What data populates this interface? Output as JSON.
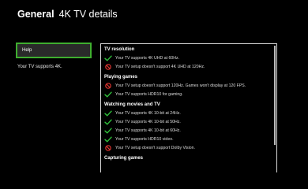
{
  "header": {
    "section": "General",
    "page": "4K TV details"
  },
  "sidebar": {
    "help_label": "Help",
    "status": "Your TV supports 4K."
  },
  "details": {
    "groups": [
      {
        "heading": "TV resolution",
        "items": [
          {
            "status": "pass",
            "icon": "check-icon",
            "text": "Your TV supports 4K UHD at 60Hz."
          },
          {
            "status": "fail",
            "icon": "not-supported-icon",
            "text": "Your TV setup doesn't support 4K UHD at 120Hz."
          }
        ]
      },
      {
        "heading": "Playing games",
        "items": [
          {
            "status": "fail",
            "icon": "not-supported-icon",
            "text": "Your TV setup doesn't support 120Hz. Games won't display at 120 FPS."
          },
          {
            "status": "pass",
            "icon": "check-icon",
            "text": "Your TV supports HDR10 for gaming."
          }
        ]
      },
      {
        "heading": "Watching movies and TV",
        "items": [
          {
            "status": "pass",
            "icon": "check-icon",
            "text": "Your TV supports 4K 10-bit at 24Hz."
          },
          {
            "status": "pass",
            "icon": "check-icon",
            "text": "Your TV supports 4K 10-bit at 50Hz."
          },
          {
            "status": "pass",
            "icon": "check-icon",
            "text": "Your TV supports 4K 10-bit at 60Hz."
          },
          {
            "status": "pass",
            "icon": "check-icon",
            "text": "Your TV supports HDR10 video."
          },
          {
            "status": "fail",
            "icon": "not-supported-icon",
            "text": "Your TV setup doesn't support Dolby Vision."
          }
        ]
      },
      {
        "heading": "Capturing games",
        "items": []
      }
    ]
  },
  "colors": {
    "background": "#000000",
    "focus_border": "#3fae2f",
    "pass": "#2fbf3a",
    "fail": "#e0342f",
    "panel_border": "#d9d9d9"
  }
}
